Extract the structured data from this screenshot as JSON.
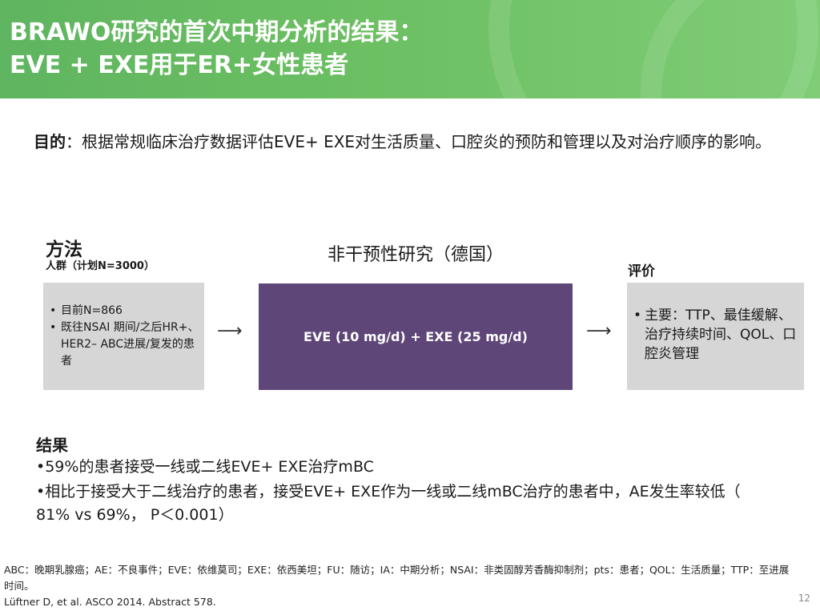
{
  "header": {
    "title_line1": "BRAWO研究的首次中期分析的结果：",
    "title_line2": "EVE + EXE用于ER+女性患者"
  },
  "objective": {
    "label": "目的",
    "colon": "：",
    "text": "根据常规临床治疗数据评估EVE+ EXE对生活质量、口腔炎的预防和管理以及对治疗顺序的影响。"
  },
  "method": {
    "title": "方法",
    "subtitle": "人群（计划N=3000）",
    "population_items": [
      "目前N=866",
      "既往NSAI 期间/之后HR+、HER2– ABC进展/复发的患者"
    ]
  },
  "study": {
    "title": "非干预性研究（德国）",
    "treatment": "EVE (10 mg/d) + EXE (25 mg/d)",
    "arrow_glyph": "⟶"
  },
  "evaluation": {
    "title": "评价",
    "items": [
      "主要：TTP、最佳缓解、治疗持续时间、QOL、口腔炎管理"
    ]
  },
  "results": {
    "title": "结果",
    "items": [
      "•59%的患者接受一线或二线EVE+ EXE治疗mBC",
      "•相比于接受大于二线治疗的患者，接受EVE+ EXE作为一线或二线mBC治疗的患者中，AE发生率较低（ 81% vs 69%， P＜0.001）"
    ]
  },
  "footnote": {
    "abbreviations": "ABC：晚期乳腺癌；AE：不良事件；EVE：依维莫司；EXE：依西美坦；FU：随访；IA：中期分析；NSAI：非类固醇芳香酶抑制剂；pts：患者；QOL：生活质量；TTP：至进展时间。",
    "reference": "Lüftner D, et al. ASCO 2014. Abstract 578."
  },
  "page_number": "12",
  "colors": {
    "header_green": "#6cbf62",
    "treatment_purple": "#5e4678",
    "box_grey": "#d6d6d6"
  }
}
